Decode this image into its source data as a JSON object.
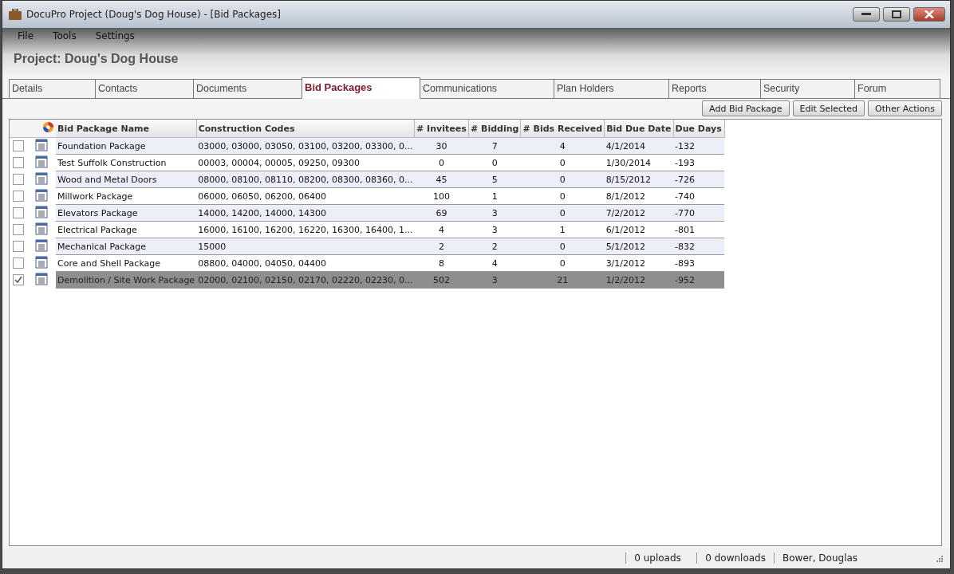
{
  "window": {
    "title": "DocuPro Project (Doug's Dog House) - [Bid Packages]"
  },
  "menu": [
    "File",
    "Tools",
    "Settings"
  ],
  "project_title": "Project: Doug's Dog House",
  "tabs": [
    {
      "label": "Details",
      "selected": false
    },
    {
      "label": "Contacts",
      "selected": false
    },
    {
      "label": "Documents",
      "selected": false
    },
    {
      "label": "Bid Packages",
      "selected": true
    },
    {
      "label": "Communications",
      "selected": false
    },
    {
      "label": "Plan Holders",
      "selected": false
    },
    {
      "label": "Reports",
      "selected": false
    },
    {
      "label": "Security",
      "selected": false
    },
    {
      "label": "Forum",
      "selected": false
    }
  ],
  "toolbar_buttons": [
    "Add Bid Package",
    "Edit Selected",
    "Other Actions"
  ],
  "table": {
    "columns": [
      "Bid Package Name",
      "Construction Codes",
      "# Invitees",
      "# Bidding",
      "# Bids Received",
      "Bid Due Date",
      "Due Days"
    ],
    "rows": [
      {
        "checked": false,
        "selected": false,
        "cells": [
          "Foundation Package",
          "03000, 03000, 03050, 03100, 03200, 03300, 0...",
          "30",
          "7",
          "4",
          "4/1/2014",
          "-132"
        ]
      },
      {
        "checked": false,
        "selected": false,
        "cells": [
          "Test Suffolk Construction",
          "00003, 00004, 00005, 09250, 09300",
          "0",
          "0",
          "0",
          "1/30/2014",
          "-193"
        ]
      },
      {
        "checked": false,
        "selected": false,
        "cells": [
          "Wood and Metal Doors",
          "08000, 08100, 08110, 08200, 08300, 08360, 0...",
          "45",
          "5",
          "0",
          "8/15/2012",
          "-726"
        ]
      },
      {
        "checked": false,
        "selected": false,
        "cells": [
          "Millwork Package",
          "06000, 06050, 06200, 06400",
          "100",
          "1",
          "0",
          "8/1/2012",
          "-740"
        ]
      },
      {
        "checked": false,
        "selected": false,
        "cells": [
          "Elevators Package",
          "14000, 14200, 14000, 14300",
          "69",
          "3",
          "0",
          "7/2/2012",
          "-770"
        ]
      },
      {
        "checked": false,
        "selected": false,
        "cells": [
          "Electrical Package",
          "16000, 16100, 16200, 16220, 16300, 16400, 1...",
          "4",
          "3",
          "1",
          "6/1/2012",
          "-801"
        ]
      },
      {
        "checked": false,
        "selected": false,
        "cells": [
          "Mechanical Package",
          "15000",
          "2",
          "2",
          "0",
          "5/1/2012",
          "-832"
        ]
      },
      {
        "checked": false,
        "selected": false,
        "cells": [
          "Core and Shell Package",
          "08800, 04000, 04050, 04400",
          "8",
          "4",
          "0",
          "3/1/2012",
          "-893"
        ]
      },
      {
        "checked": true,
        "selected": true,
        "cells": [
          "Demolition / Site Work Package",
          "02000, 02100, 02150, 02170, 02220, 02230, 0...",
          "502",
          "3",
          "21",
          "1/2/2012",
          "-952"
        ]
      }
    ]
  },
  "status_bar": [
    "0 uploads",
    "0 downloads",
    "Bower, Douglas"
  ]
}
